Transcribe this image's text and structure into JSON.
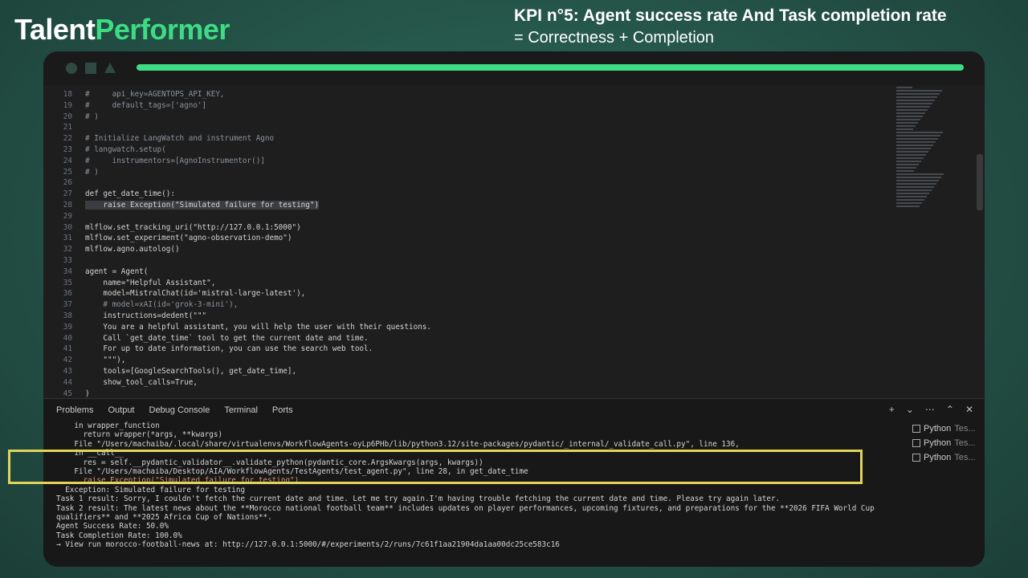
{
  "header": {
    "brand_a": "Talent",
    "brand_b": "Performer",
    "kpi_title": "KPI n°5: Agent success rate And Task completion rate",
    "kpi_sub": "= Correctness + Completion"
  },
  "progress": {
    "fraction": 1.0
  },
  "editor": {
    "lines": [
      {
        "n": "18",
        "t": "#     api_key=AGENTOPS_API_KEY,"
      },
      {
        "n": "19",
        "t": "#     default_tags=['agno']"
      },
      {
        "n": "20",
        "t": "# )"
      },
      {
        "n": "21",
        "t": ""
      },
      {
        "n": "22",
        "t": "# Initialize LangWatch and instrument Agno"
      },
      {
        "n": "23",
        "t": "# langwatch.setup("
      },
      {
        "n": "24",
        "t": "#     instrumentors=[AgnoInstrumentor()]"
      },
      {
        "n": "25",
        "t": "# )"
      },
      {
        "n": "26",
        "t": ""
      },
      {
        "n": "27",
        "t": "def get_date_time():"
      },
      {
        "n": "28",
        "t": "    raise Exception(\"Simulated failure for testing\")"
      },
      {
        "n": "29",
        "t": ""
      },
      {
        "n": "30",
        "t": "mlflow.set_tracking_uri(\"http://127.0.0.1:5000\")"
      },
      {
        "n": "31",
        "t": "mlflow.set_experiment(\"agno-observation-demo\")"
      },
      {
        "n": "32",
        "t": "mlflow.agno.autolog()"
      },
      {
        "n": "33",
        "t": ""
      },
      {
        "n": "34",
        "t": "agent = Agent("
      },
      {
        "n": "35",
        "t": "    name=\"Helpful Assistant\","
      },
      {
        "n": "36",
        "t": "    model=MistralChat(id='mistral-large-latest'),"
      },
      {
        "n": "37",
        "t": "    # model=xAI(id='grok-3-mini'),"
      },
      {
        "n": "38",
        "t": "    instructions=dedent(\"\"\""
      },
      {
        "n": "39",
        "t": "    You are a helpful assistant, you will help the user with their questions."
      },
      {
        "n": "40",
        "t": "    Call `get_date_time` tool to get the current date and time."
      },
      {
        "n": "41",
        "t": "    For up to date information, you can use the search web tool."
      },
      {
        "n": "42",
        "t": "    \"\"\"),"
      },
      {
        "n": "43",
        "t": "    tools=[GoogleSearchTools(), get_date_time],"
      },
      {
        "n": "44",
        "t": "    show_tool_calls=True,"
      },
      {
        "n": "45",
        "t": ")"
      }
    ]
  },
  "panel": {
    "tabs": [
      "Problems",
      "Output",
      "Debug Console",
      "Terminal",
      "Ports"
    ],
    "terminals": [
      "Python",
      "Python",
      "Python"
    ],
    "terminal_suffix": "Tes...",
    "lines": [
      "    in wrapper_function",
      "      return wrapper(*args, **kwargs)",
      "",
      "    File \"/Users/machaiba/.local/share/virtualenvs/WorkflowAgents-oyLp6PHb/lib/python3.12/site-packages/pydantic/_internal/_validate_call.py\", line 136,",
      "    in __call__",
      "      res = self.__pydantic_validator__.validate_python(pydantic_core.ArgsKwargs(args, kwargs))",
      "",
      "    File \"/Users/machaiba/Desktop/AIA/WorkflowAgents/TestAgents/test_agent.py\", line 28, in get_date_time",
      "      raise Exception(\"Simulated failure for testing\")",
      "  Exception: Simulated failure for testing",
      "Task 1 result: Sorry, I couldn't fetch the current date and time. Let me try again.I'm having trouble fetching the current date and time. Please try again later.",
      "Task 2 result: The latest news about the **Morocco national football team** includes updates on player performances, upcoming fixtures, and preparations for the **2026 FIFA World Cup",
      "qualifiers** and **2025 Africa Cup of Nations**.",
      "Agent Success Rate: 50.0%",
      "Task Completion Rate: 100.0%",
      "→ View run morocco-football-news at: http://127.0.0.1:5000/#/experiments/2/runs/7c61f1aa21904da1aa00dc25ce583c16"
    ]
  }
}
